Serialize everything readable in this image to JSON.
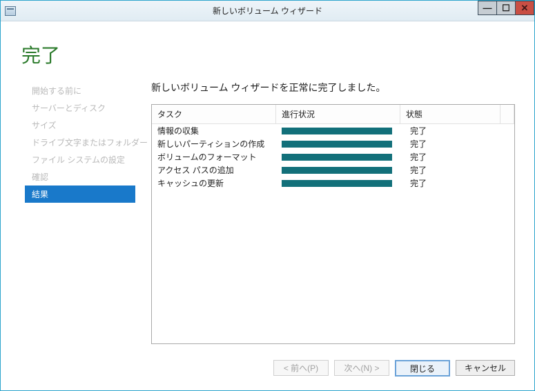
{
  "window": {
    "title": "新しいボリューム ウィザード"
  },
  "page": {
    "title": "完了",
    "heading": "新しいボリューム ウィザードを正常に完了しました。"
  },
  "sidebar": {
    "items": [
      {
        "label": "開始する前に",
        "active": false
      },
      {
        "label": "サーバーとディスク",
        "active": false
      },
      {
        "label": "サイズ",
        "active": false
      },
      {
        "label": "ドライブ文字またはフォルダー",
        "active": false
      },
      {
        "label": "ファイル システムの設定",
        "active": false
      },
      {
        "label": "確認",
        "active": false
      },
      {
        "label": "結果",
        "active": true
      }
    ]
  },
  "results": {
    "columns": {
      "task": "タスク",
      "progress": "進行状況",
      "status": "状態"
    },
    "rows": [
      {
        "task": "情報の収集",
        "status": "完了"
      },
      {
        "task": "新しいパーティションの作成",
        "status": "完了"
      },
      {
        "task": "ボリュームのフォーマット",
        "status": "完了"
      },
      {
        "task": "アクセス パスの追加",
        "status": "完了"
      },
      {
        "task": "キャッシュの更新",
        "status": "完了"
      }
    ]
  },
  "buttons": {
    "prev": "< 前へ(P)",
    "next": "次へ(N) >",
    "close": "閉じる",
    "cancel": "キャンセル"
  }
}
